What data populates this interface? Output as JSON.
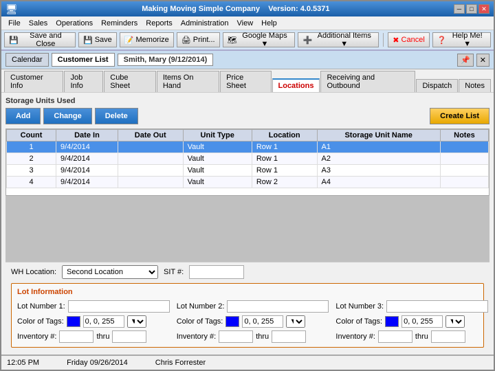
{
  "window": {
    "title": "Making Moving Simple Company",
    "version": "Version: 4.0.5371"
  },
  "menu": {
    "items": [
      "File",
      "Sales",
      "Operations",
      "Reminders",
      "Reports",
      "Administration",
      "View",
      "Help"
    ]
  },
  "toolbar": {
    "buttons": [
      {
        "label": "Save and Close",
        "icon": "💾"
      },
      {
        "label": "Save",
        "icon": "💾"
      },
      {
        "label": "Memorize",
        "icon": "📝"
      },
      {
        "label": "Print...",
        "icon": "🖨"
      },
      {
        "label": "Google Maps ▼",
        "icon": "🗺"
      },
      {
        "label": "Additional Items ▼",
        "icon": "➕"
      },
      {
        "label": "Cancel",
        "icon": "✖"
      },
      {
        "label": "Help Me! ▼",
        "icon": "❓"
      }
    ]
  },
  "customer_tabs": {
    "tabs": [
      "Calendar",
      "Customer List"
    ],
    "active": "Customer List",
    "customer_name": "Smith, Mary (9/12/2014)"
  },
  "sub_tabs": {
    "tabs": [
      "Customer Info",
      "Job Info",
      "Cube Sheet",
      "Items On Hand",
      "Price Sheet",
      "Locations",
      "Receiving and Outbound",
      "Dispatch",
      "Notes"
    ],
    "active": "Locations"
  },
  "section": {
    "title": "Storage Units Used"
  },
  "action_buttons": {
    "add": "Add",
    "change": "Change",
    "delete": "Delete",
    "create_list": "Create List"
  },
  "table": {
    "columns": [
      "Count",
      "Date In",
      "Date Out",
      "Unit Type",
      "Location",
      "Storage Unit Name",
      "Notes"
    ],
    "rows": [
      {
        "count": "1",
        "date_in": "9/4/2014",
        "date_out": "",
        "unit_type": "Vault",
        "location": "Row 1",
        "storage_unit_name": "A1",
        "notes": "",
        "selected": true
      },
      {
        "count": "2",
        "date_in": "9/4/2014",
        "date_out": "",
        "unit_type": "Vault",
        "location": "Row 1",
        "storage_unit_name": "A2",
        "notes": "",
        "selected": false
      },
      {
        "count": "3",
        "date_in": "9/4/2014",
        "date_out": "",
        "unit_type": "Vault",
        "location": "Row 1",
        "storage_unit_name": "A3",
        "notes": "",
        "selected": false
      },
      {
        "count": "4",
        "date_in": "9/4/2014",
        "date_out": "",
        "unit_type": "Vault",
        "location": "Row 2",
        "storage_unit_name": "A4",
        "notes": "",
        "selected": false
      }
    ]
  },
  "footer": {
    "wh_location_label": "WH Location:",
    "wh_location_value": "Second Location",
    "sit_label": "SIT #:",
    "sit_value": "",
    "lot_info_title": "Lot Information",
    "lot_number_1_label": "Lot Number 1:",
    "lot_number_1_value": "",
    "lot_number_2_label": "Lot Number 2:",
    "lot_number_2_value": "",
    "lot_number_3_label": "Lot Number 3:",
    "lot_number_3_value": "",
    "color_label": "Color of Tags:",
    "color_value_1": "0, 0, 255",
    "color_value_2": "0, 0, 255",
    "color_value_3": "0, 0, 255",
    "inventory_label": "Inventory #:",
    "thru_label": "thru",
    "inventory_1_from": "",
    "inventory_1_thru": "",
    "inventory_2_from": "",
    "inventory_2_thru": "",
    "inventory_3_from": "",
    "inventory_3_thru": ""
  },
  "status_bar": {
    "time": "12:05 PM",
    "date": "Friday 09/26/2014",
    "user": "Chris Forrester"
  }
}
